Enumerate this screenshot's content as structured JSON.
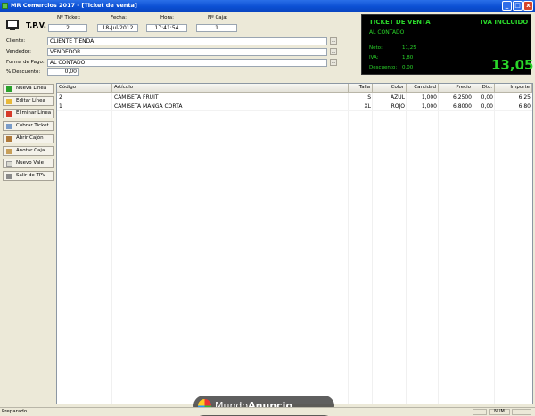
{
  "window": {
    "title": "MR Comercios 2017 - [Ticket de venta]",
    "controls": {
      "minimize": "_",
      "maximize": "□",
      "close": "x"
    }
  },
  "header": {
    "tpv_label": "T.P.V.",
    "ticket_label": "Nº Ticket:",
    "ticket_value": "2",
    "fecha_label": "Fecha:",
    "fecha_value": "18-Jul-2012",
    "hora_label": "Hora:",
    "hora_value": "17:41:54",
    "caja_label": "Nº Caja:",
    "caja_value": "1",
    "cliente_label": "Cliente:",
    "cliente_value": "CLIENTE TIENDA",
    "vendedor_label": "Vendedor:",
    "vendedor_value": "VENDEDOR",
    "pago_label": "Forma de Pago:",
    "pago_value": "AL CONTADO",
    "descuento_label": "% Descuento:",
    "descuento_value": "0,00",
    "search_glyph": "..."
  },
  "display": {
    "title": "TICKET DE VENTA",
    "iva_included": "IVA INCLUIDO",
    "forma_pago": "AL CONTADO",
    "neto_label": "Neto:",
    "neto_value": "11,25",
    "iva_label": "IVA:",
    "iva_value": "1,80",
    "descuento_label": "Descuento:",
    "descuento_value": "0,00",
    "total": "13,05",
    "text_color": "#2ad52a"
  },
  "sidebar": {
    "items": [
      {
        "label": "Nueva Línea",
        "icon": "plus-icon"
      },
      {
        "label": "Editar Línea",
        "icon": "pencil-icon"
      },
      {
        "label": "Eliminar Línea",
        "icon": "delete-icon"
      },
      {
        "label": "Cobrar Ticket",
        "icon": "cash-icon"
      },
      {
        "label": "Abrir Cajón",
        "icon": "drawer-icon"
      },
      {
        "label": "Anotar Caja",
        "icon": "note-icon"
      },
      {
        "label": "Nuevo Vale",
        "icon": "voucher-icon"
      },
      {
        "label": "Salir de TPV",
        "icon": "exit-icon"
      }
    ]
  },
  "table": {
    "columns": [
      "Código",
      "Artículo",
      "Talla",
      "Color",
      "Cantidad",
      "Precio",
      "Dto.",
      "Importe"
    ],
    "rows": [
      [
        "2",
        "CAMISETA FRUIT",
        "S",
        "AZUL",
        "1,000",
        "6,2500",
        "0,00",
        "6,25"
      ],
      [
        "1",
        "CAMISETA MANGA CORTA",
        "XL",
        "ROJO",
        "1,000",
        "6,8000",
        "0,00",
        "6,80"
      ]
    ]
  },
  "status": {
    "text": "Preparado",
    "num": "NUM"
  },
  "watermark": {
    "brand_a": "Mundo",
    "brand_b": "Anuncio"
  }
}
